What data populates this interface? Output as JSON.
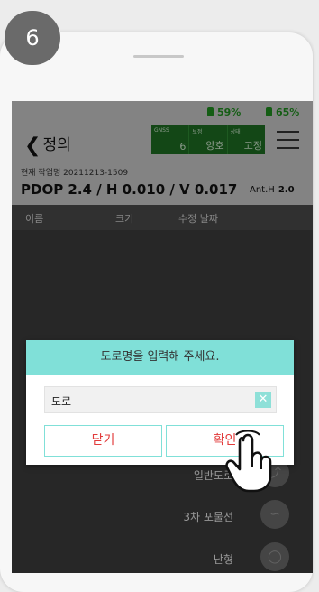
{
  "step": "6",
  "status_bar": {
    "gnss_text": "59%",
    "battery_text": "65%",
    "color": "#1f8f1f"
  },
  "header": {
    "back_label": "정의",
    "gnss_panel": [
      {
        "label": "GNSS",
        "value": "6"
      },
      {
        "label": "보정",
        "value": "양호"
      },
      {
        "label": "상태",
        "value": "고정"
      }
    ],
    "menu_icon": "hamburger-icon"
  },
  "job_line": "현재 작업명 20211213-1509",
  "pdop_line": "PDOP 2.4 / H 0.010 / V 0.017",
  "ant_h": {
    "label": "Ant.H",
    "value": "2.0"
  },
  "columns": [
    "이름",
    "크기",
    "수정 날짜"
  ],
  "road_types": [
    {
      "label": "일반도로",
      "icon": "curve-road-icon"
    },
    {
      "label": "3차 포물선",
      "icon": "parabola-icon"
    },
    {
      "label": "난형",
      "icon": "oval-icon"
    }
  ],
  "dialog": {
    "title": "도로명을 입력해 주세요.",
    "input_value": "도로",
    "clear_icon": "clear-icon",
    "close_label": "닫기",
    "confirm_label": "확인",
    "accent": "#80e0d8",
    "button_text_color": "#e23b3b"
  }
}
